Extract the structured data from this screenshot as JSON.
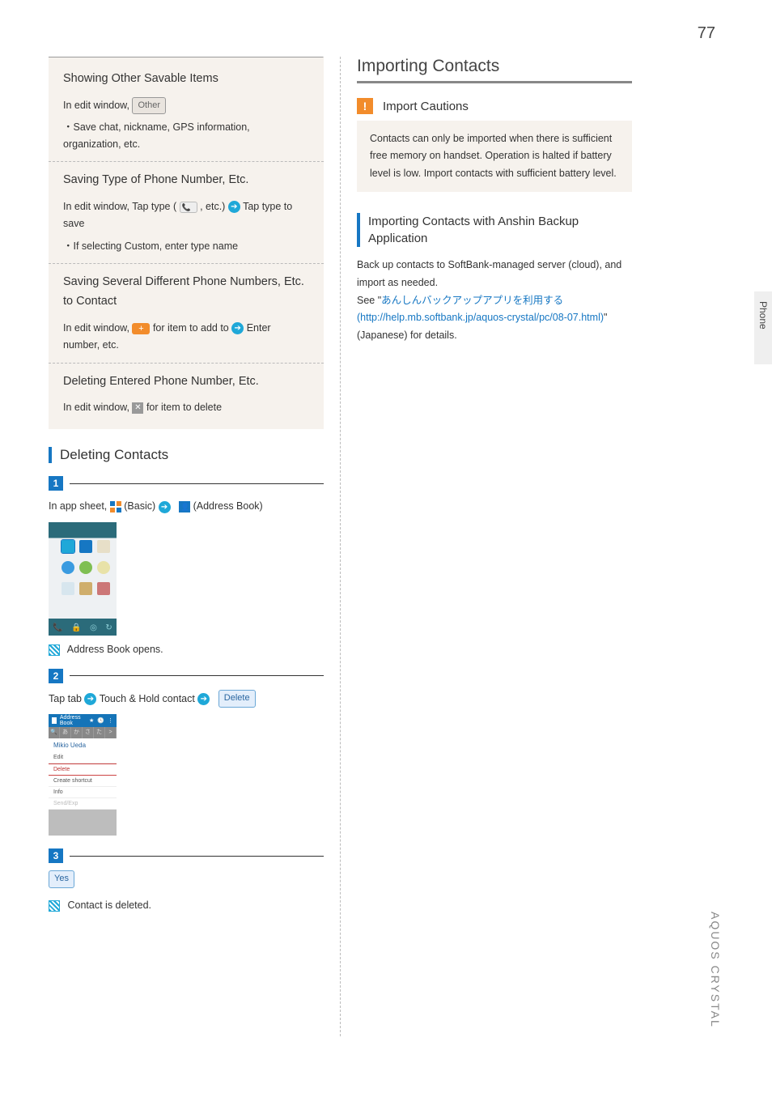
{
  "page_number": "77",
  "side_tab": "Phone",
  "brand": "AQUOS CRYSTAL",
  "left": {
    "box": {
      "s1_title": "Showing Other Savable Items",
      "s1_l1a": "In edit window,  ",
      "s1_tag": "Other",
      "s1_l2": "・Save chat, nickname, GPS information, organization, etc.",
      "s2_title": "Saving Type of Phone Number, Etc.",
      "s2_l1a": "In edit window, Tap type (  ",
      "s2_l1b": "  , etc.) ",
      "s2_l1c": " Tap type to save",
      "s2_l2": "・If selecting Custom, enter type name",
      "s3_title": "Saving Several Different Phone Numbers, Etc. to Contact",
      "s3_l1a": "In edit window,  ",
      "s3_l1b": "  for item to add to ",
      "s3_l1c": " Enter number, etc.",
      "s4_title": "Deleting Entered Phone Number, Etc.",
      "s4_l1a": "In edit window,  ",
      "s4_l1b": "  for item to delete"
    },
    "heading": "Deleting Contacts",
    "step1": {
      "n": "1",
      "l1a": "In app sheet,  ",
      "l1b": "  (Basic) ",
      "l1c": "  (Address Book)",
      "result": "Address Book opens."
    },
    "step2": {
      "n": "2",
      "l1a": "Tap tab ",
      "l1b": " Touch & Hold contact ",
      "delete_tag": "Delete"
    },
    "device_b": {
      "title": "Address Book",
      "name": "Mikio Ueda",
      "m1": "Edit",
      "m2": "Delete",
      "m3": "Create shortcut",
      "m4": "Info",
      "m5": "Send/Exp"
    },
    "step3": {
      "n": "3",
      "yes_tag": "Yes",
      "result": "Contact is deleted."
    }
  },
  "right": {
    "h": "Importing Contacts",
    "caution_title": "Import Cautions",
    "caution_body": "Contacts can only be imported when there is sufficient free memory on handset. Operation is halted if battery level is low. Import contacts with sufficient battery level.",
    "sub_h": "Importing Contacts with Anshin Backup Application",
    "p1": "Back up contacts to SoftBank-managed server (cloud), and import as needed.",
    "p2a": "See \"",
    "p2link": "あんしんバックアップアプリを利用する (http://help.mb.softbank.jp/aquos-crystal/pc/08-07.html)",
    "p2b": "\" (Japanese) for details."
  }
}
